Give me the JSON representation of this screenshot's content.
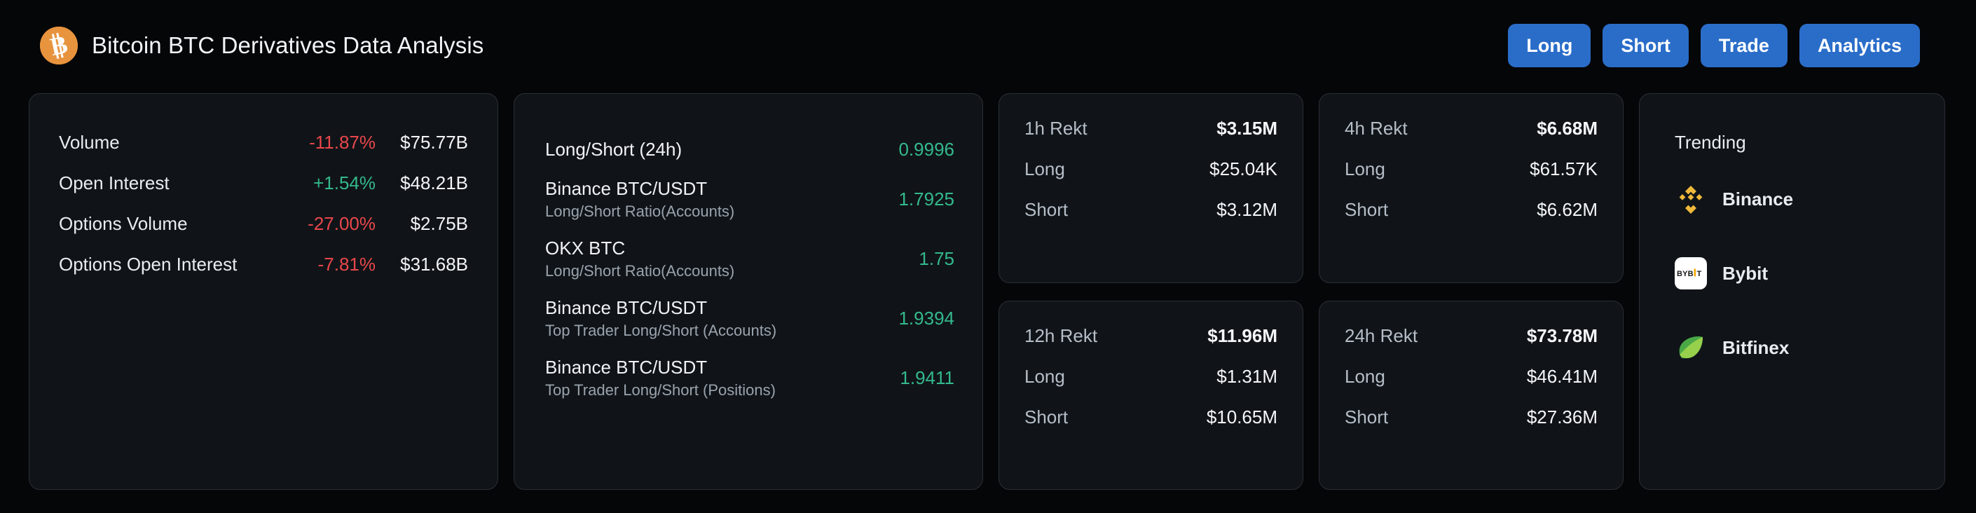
{
  "header": {
    "logo_icon": "bitcoin-icon",
    "title": "Bitcoin BTC Derivatives Data Analysis",
    "buttons": [
      {
        "label": "Long"
      },
      {
        "label": "Short"
      },
      {
        "label": "Trade"
      },
      {
        "label": "Analytics"
      }
    ]
  },
  "metrics_card": {
    "rows": [
      {
        "label": "Volume",
        "change": "-11.87%",
        "direction": "down",
        "value": "$75.77B"
      },
      {
        "label": "Open Interest",
        "change": "+1.54%",
        "direction": "up",
        "value": "$48.21B"
      },
      {
        "label": "Options Volume",
        "change": "-27.00%",
        "direction": "down",
        "value": "$2.75B"
      },
      {
        "label": "Options Open Interest",
        "change": "-7.81%",
        "direction": "down",
        "value": "$31.68B"
      }
    ]
  },
  "ratios_card": {
    "rows": [
      {
        "title": "Long/Short (24h)",
        "sub": "",
        "value": "0.9996"
      },
      {
        "title": "Binance BTC/USDT",
        "sub": "Long/Short Ratio(Accounts)",
        "value": "1.7925"
      },
      {
        "title": "OKX BTC",
        "sub": "Long/Short Ratio(Accounts)",
        "value": "1.75"
      },
      {
        "title": "Binance BTC/USDT",
        "sub": "Top Trader Long/Short (Accounts)",
        "value": "1.9394"
      },
      {
        "title": "Binance BTC/USDT",
        "sub": "Top Trader Long/Short (Positions)",
        "value": "1.9411"
      }
    ]
  },
  "rekt_cards": [
    {
      "title": "1h Rekt",
      "total": "$3.15M",
      "long_label": "Long",
      "long_value": "$25.04K",
      "short_label": "Short",
      "short_value": "$3.12M"
    },
    {
      "title": "4h Rekt",
      "total": "$6.68M",
      "long_label": "Long",
      "long_value": "$61.57K",
      "short_label": "Short",
      "short_value": "$6.62M"
    },
    {
      "title": "12h Rekt",
      "total": "$11.96M",
      "long_label": "Long",
      "long_value": "$1.31M",
      "short_label": "Short",
      "short_value": "$10.65M"
    },
    {
      "title": "24h Rekt",
      "total": "$73.78M",
      "long_label": "Long",
      "long_value": "$46.41M",
      "short_label": "Short",
      "short_value": "$27.36M"
    }
  ],
  "trending_card": {
    "title": "Trending",
    "items": [
      {
        "name": "Binance",
        "icon": "binance-logo-icon"
      },
      {
        "name": "Bybit",
        "icon": "bybit-logo-icon"
      },
      {
        "name": "Bitfinex",
        "icon": "bitfinex-logo-icon"
      }
    ]
  },
  "colors": {
    "background": "#050608",
    "card": "#101418",
    "card_border": "#2a2f36",
    "accent_button": "#2a6dc9",
    "positive": "#34b98c",
    "negative": "#e8474c",
    "bitcoin": "#e8933e",
    "binance": "#efb93b",
    "bitfinex": "#56af45"
  }
}
